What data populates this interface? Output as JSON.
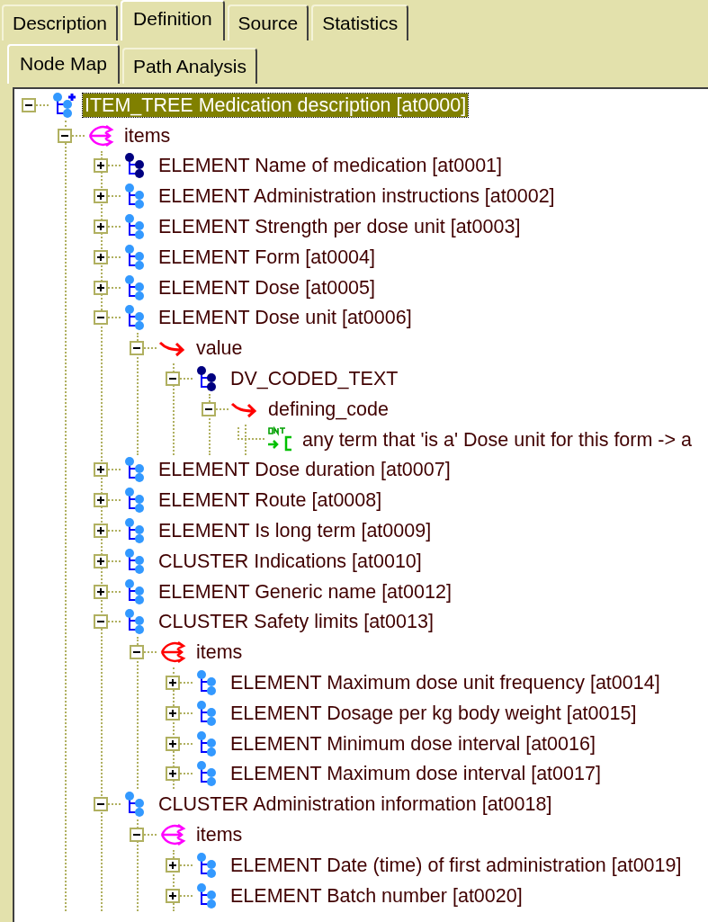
{
  "tabs": [
    {
      "label": "Description",
      "selected": false
    },
    {
      "label": "Definition",
      "selected": true
    },
    {
      "label": "Source",
      "selected": false
    },
    {
      "label": "Statistics",
      "selected": false
    }
  ],
  "subtabs": [
    {
      "label": "Node Map",
      "selected": true
    },
    {
      "label": "Path Analysis",
      "selected": false
    }
  ],
  "tree": [
    {
      "kind": "object",
      "label": "ITEM_TREE Medication description [at0000]",
      "color": "#3399ff",
      "expanded": true,
      "selected": true,
      "children": [
        {
          "kind": "multiple",
          "label": "items",
          "color": "#ff00ff",
          "expanded": true,
          "selected": false,
          "children": [
            {
              "kind": "object",
              "label": "ELEMENT Name of medication [at0001]",
              "color": "#000080",
              "expanded": false,
              "selected": false
            },
            {
              "kind": "object",
              "label": "ELEMENT Administration instructions [at0002]",
              "color": "#3399ff",
              "expanded": false,
              "selected": false
            },
            {
              "kind": "object",
              "label": "ELEMENT Strength per dose unit [at0003]",
              "color": "#3399ff",
              "expanded": false,
              "selected": false
            },
            {
              "kind": "object",
              "label": "ELEMENT Form [at0004]",
              "color": "#3399ff",
              "expanded": false,
              "selected": false
            },
            {
              "kind": "object",
              "label": "ELEMENT Dose [at0005]",
              "color": "#3399ff",
              "expanded": false,
              "selected": false
            },
            {
              "kind": "object",
              "label": "ELEMENT Dose unit [at0006]",
              "color": "#3399ff",
              "expanded": true,
              "selected": false,
              "children": [
                {
                  "kind": "single",
                  "label": "value",
                  "expanded": true,
                  "selected": false,
                  "children": [
                    {
                      "kind": "object",
                      "label": "DV_CODED_TEXT",
                      "color": "#000080",
                      "expanded": true,
                      "selected": false,
                      "children": [
                        {
                          "kind": "single",
                          "label": "defining_code",
                          "expanded": true,
                          "selected": false,
                          "children": [
                            {
                              "kind": "ontology",
                              "label": "any term that 'is a' Dose unit for this form -> a",
                              "selected": false
                            }
                          ]
                        }
                      ]
                    }
                  ]
                }
              ]
            },
            {
              "kind": "object",
              "label": "ELEMENT Dose duration [at0007]",
              "color": "#3399ff",
              "expanded": false,
              "selected": false
            },
            {
              "kind": "object",
              "label": "ELEMENT Route [at0008]",
              "color": "#3399ff",
              "expanded": false,
              "selected": false
            },
            {
              "kind": "object",
              "label": "ELEMENT Is long term [at0009]",
              "color": "#3399ff",
              "expanded": false,
              "selected": false
            },
            {
              "kind": "object",
              "label": "CLUSTER Indications [at0010]",
              "color": "#3399ff",
              "expanded": false,
              "selected": false
            },
            {
              "kind": "object",
              "label": "ELEMENT Generic name [at0012]",
              "color": "#3399ff",
              "expanded": false,
              "selected": false
            },
            {
              "kind": "object",
              "label": "CLUSTER Safety limits [at0013]",
              "color": "#3399ff",
              "expanded": true,
              "selected": false,
              "children": [
                {
                  "kind": "multiple",
                  "label": "items",
                  "color": "#ff0000",
                  "expanded": true,
                  "selected": false,
                  "children": [
                    {
                      "kind": "object",
                      "label": "ELEMENT Maximum dose unit frequency [at0014]",
                      "color": "#3399ff",
                      "expanded": false,
                      "selected": false
                    },
                    {
                      "kind": "object",
                      "label": "ELEMENT Dosage per kg body weight [at0015]",
                      "color": "#3399ff",
                      "expanded": false,
                      "selected": false
                    },
                    {
                      "kind": "object",
                      "label": "ELEMENT Minimum dose interval [at0016]",
                      "color": "#3399ff",
                      "expanded": false,
                      "selected": false
                    },
                    {
                      "kind": "object",
                      "label": "ELEMENT Maximum dose interval [at0017]",
                      "color": "#3399ff",
                      "expanded": false,
                      "selected": false
                    }
                  ]
                }
              ]
            },
            {
              "kind": "object",
              "label": "CLUSTER Administration information [at0018]",
              "color": "#3399ff",
              "expanded": true,
              "selected": false,
              "children": [
                {
                  "kind": "multiple",
                  "label": "items",
                  "color": "#ff00ff",
                  "expanded": true,
                  "selected": false,
                  "children": [
                    {
                      "kind": "object",
                      "label": "ELEMENT Date (time) of first administration [at0019]",
                      "color": "#3399ff",
                      "expanded": false,
                      "selected": false
                    },
                    {
                      "kind": "object",
                      "label": "ELEMENT Batch number [at0020]",
                      "color": "#3399ff",
                      "expanded": false,
                      "selected": false
                    }
                  ]
                }
              ]
            }
          ]
        }
      ]
    }
  ]
}
